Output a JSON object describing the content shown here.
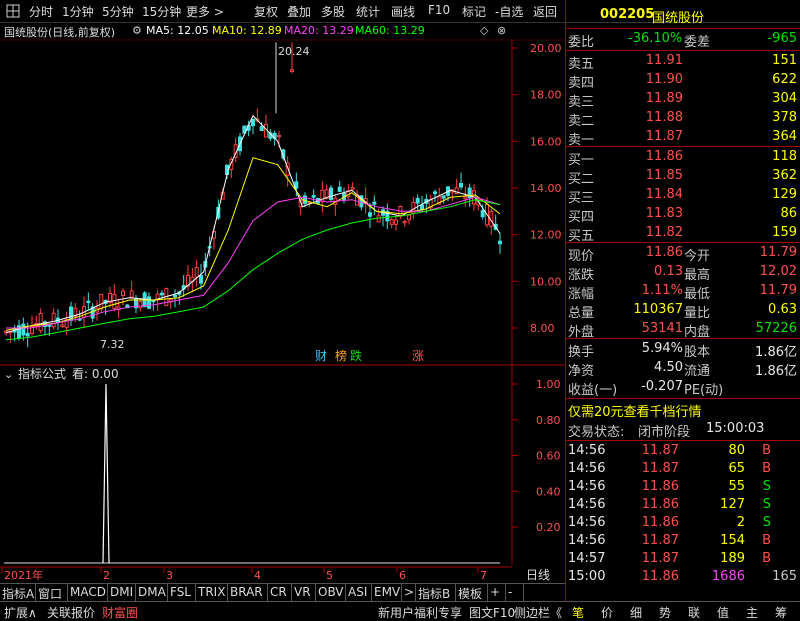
{
  "toolbar": {
    "left": [
      "分时",
      "1分钟",
      "5分钟",
      "15分钟",
      "更多 >"
    ],
    "right": [
      "复权",
      "叠加",
      "多股",
      "统计",
      "画线",
      "F10",
      "标记",
      "-自选",
      "返回"
    ]
  },
  "chart": {
    "stock_label": "国统股份(日线,前复权)",
    "ma": [
      {
        "name": "MA5",
        "value": "12.05",
        "color": "#ffffff"
      },
      {
        "name": "MA10",
        "value": "12.89",
        "color": "#ffff00"
      },
      {
        "name": "MA20",
        "value": "13.29",
        "color": "#ff40ff"
      },
      {
        "name": "MA60",
        "value": "13.29",
        "color": "#00ff00"
      }
    ],
    "high_label": "20.24",
    "low_label": "7.32",
    "y_ticks": [
      "20.00",
      "18.00",
      "16.00",
      "14.00",
      "12.00",
      "10.00",
      "8.00"
    ],
    "markers": [
      {
        "text": "财",
        "color": "#40c0ff"
      },
      {
        "text": "榜",
        "color": "#ffaa00"
      },
      {
        "text": "跌",
        "color": "#00e000"
      },
      {
        "text": "涨",
        "color": "#ff5050"
      }
    ],
    "indicator_title": "指标公式",
    "indicator_value": "看: 0.00",
    "ind_y_ticks": [
      "1.00",
      "0.80",
      "0.60",
      "0.40",
      "0.20"
    ],
    "x_labels": [
      "2021年",
      "2",
      "3",
      "4",
      "5",
      "6",
      "7"
    ],
    "period": "日线"
  },
  "chart_data": {
    "type": "line",
    "title": "国统股份(日线,前复权)",
    "ylim": [
      7,
      21
    ],
    "series": [
      {
        "name": "MA5",
        "values": [
          7.8,
          8.1,
          8.3,
          8.6,
          9.1,
          9.3,
          9.2,
          9.5,
          10.4,
          14.8,
          17.1,
          16.0,
          13.2,
          13.6,
          13.9,
          13.0,
          12.8,
          13.4,
          13.9,
          13.6,
          12.05
        ]
      },
      {
        "name": "MA10",
        "values": [
          7.9,
          8.1,
          8.2,
          8.5,
          8.9,
          9.2,
          9.2,
          9.3,
          9.8,
          12.2,
          15.3,
          15.0,
          13.5,
          13.2,
          13.8,
          13.0,
          12.9,
          13.1,
          13.6,
          13.7,
          12.89
        ]
      },
      {
        "name": "MA20",
        "values": [
          8.0,
          8.0,
          8.2,
          8.4,
          8.7,
          8.9,
          9.0,
          9.2,
          9.4,
          10.8,
          12.6,
          13.4,
          13.6,
          13.4,
          13.5,
          13.2,
          13.0,
          13.0,
          13.3,
          13.6,
          13.29
        ]
      },
      {
        "name": "MA60",
        "values": [
          7.5,
          7.6,
          7.8,
          8.0,
          8.2,
          8.4,
          8.5,
          8.7,
          8.9,
          9.6,
          10.5,
          11.2,
          11.8,
          12.2,
          12.5,
          12.7,
          12.8,
          13.0,
          13.2,
          13.5,
          13.29
        ]
      }
    ],
    "high": 20.24,
    "low": 7.32,
    "indicator": {
      "name": "指标公式",
      "ylim": [
        0,
        1.05
      ],
      "spike_value": 1.0
    }
  },
  "quote": {
    "code": "002205",
    "name": "国统股份",
    "weibi_label": "委比",
    "weibi": "-36.10%",
    "weicha_label": "委差",
    "weicha": "-965",
    "sells": [
      {
        "label": "卖五",
        "price": "11.91",
        "vol": "151"
      },
      {
        "label": "卖四",
        "price": "11.90",
        "vol": "622"
      },
      {
        "label": "卖三",
        "price": "11.89",
        "vol": "304"
      },
      {
        "label": "卖二",
        "price": "11.88",
        "vol": "378"
      },
      {
        "label": "卖一",
        "price": "11.87",
        "vol": "364"
      }
    ],
    "buys": [
      {
        "label": "买一",
        "price": "11.86",
        "vol": "118"
      },
      {
        "label": "买二",
        "price": "11.85",
        "vol": "362"
      },
      {
        "label": "买三",
        "price": "11.84",
        "vol": "129"
      },
      {
        "label": "买四",
        "price": "11.83",
        "vol": "86"
      },
      {
        "label": "买五",
        "price": "11.82",
        "vol": "159"
      }
    ],
    "stats": [
      {
        "l1": "现价",
        "v1": "11.86",
        "l2": "今开",
        "v2": "11.79"
      },
      {
        "l1": "涨跌",
        "v1": "0.13",
        "l2": "最高",
        "v2": "12.02"
      },
      {
        "l1": "涨幅",
        "v1": "1.11%",
        "l2": "最低",
        "v2": "11.79"
      },
      {
        "l1": "总量",
        "v1": "110367",
        "l2": "量比",
        "v2": "0.63"
      },
      {
        "l1": "外盘",
        "v1": "53141",
        "l2": "内盘",
        "v2": "57226"
      }
    ],
    "stats2": [
      {
        "l1": "换手",
        "v1": "5.94%",
        "l2": "股本",
        "v2": "1.86亿"
      },
      {
        "l1": "净资",
        "v1": "4.50",
        "l2": "流通",
        "v2": "1.86亿"
      },
      {
        "l1": "收益(一)",
        "v1": "-0.207",
        "l2": "PE(动)",
        "v2": ""
      }
    ],
    "promo": "仅需20元查看千档行情",
    "trade_state_label": "交易状态:",
    "trade_state": "闭市阶段",
    "trade_state_time": "15:00:03",
    "ticks": [
      {
        "t": "14:56",
        "p": "11.87",
        "v": "80",
        "s": "B"
      },
      {
        "t": "14:56",
        "p": "11.87",
        "v": "65",
        "s": "B"
      },
      {
        "t": "14:56",
        "p": "11.86",
        "v": "55",
        "s": "S"
      },
      {
        "t": "14:56",
        "p": "11.86",
        "v": "127",
        "s": "S"
      },
      {
        "t": "14:56",
        "p": "11.86",
        "v": "2",
        "s": "S"
      },
      {
        "t": "14:56",
        "p": "11.87",
        "v": "154",
        "s": "B"
      },
      {
        "t": "14:57",
        "p": "11.87",
        "v": "189",
        "s": "B"
      },
      {
        "t": "15:00",
        "p": "11.86",
        "v": "1686",
        "s": "165"
      }
    ]
  },
  "tabs": [
    "指标A",
    "窗口",
    "MACD",
    "DMI",
    "DMA",
    "FSL",
    "TRIX",
    "BRAR",
    "CR",
    "VR",
    "OBV",
    "ASI",
    "EMV",
    ">",
    "指标B",
    "模板",
    "+",
    "-"
  ],
  "status": {
    "left": [
      "扩展∧",
      "关联报价",
      "财富圈"
    ],
    "right": [
      "新用户福利专享",
      "图文F10",
      "侧边栏《"
    ],
    "right_tabs": [
      "笔",
      "价",
      "细",
      "势",
      "联",
      "值",
      "主",
      "筹"
    ]
  }
}
